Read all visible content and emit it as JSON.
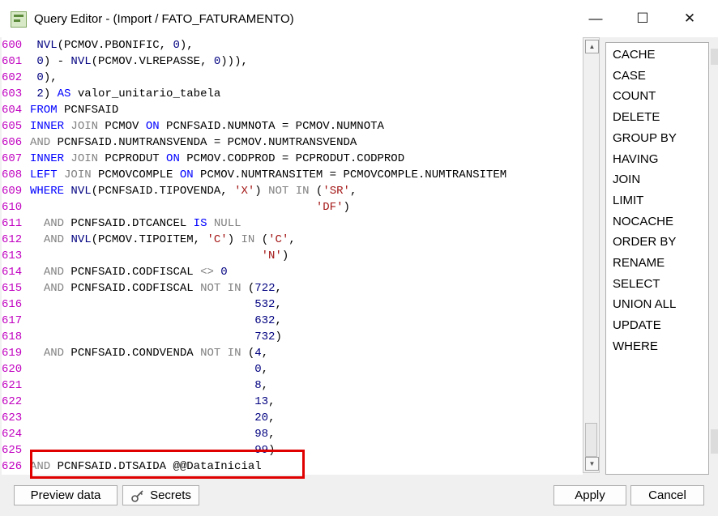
{
  "window": {
    "title": "Query Editor - (Import / FATO_FATURAMENTO)",
    "minimize_glyph": "—",
    "maximize_glyph": "☐",
    "close_glyph": "✕"
  },
  "editor": {
    "lines": [
      {
        "no": "600",
        "segs": [
          [
            "pl",
            " "
          ],
          [
            "fn",
            "NVL"
          ],
          [
            "pl",
            "(PCMOV.PBONIFIC, "
          ],
          [
            "num",
            "0"
          ],
          [
            "pl",
            "),"
          ]
        ]
      },
      {
        "no": "601",
        "segs": [
          [
            "pl",
            " "
          ],
          [
            "num",
            "0"
          ],
          [
            "pl",
            ") - "
          ],
          [
            "fn",
            "NVL"
          ],
          [
            "pl",
            "(PCMOV.VLREPASSE, "
          ],
          [
            "num",
            "0"
          ],
          [
            "pl",
            ")))"
          ],
          [
            "pl",
            ","
          ]
        ]
      },
      {
        "no": "602",
        "segs": [
          [
            "pl",
            " "
          ],
          [
            "num",
            "0"
          ],
          [
            "pl",
            "),"
          ]
        ]
      },
      {
        "no": "603",
        "segs": [
          [
            "pl",
            " "
          ],
          [
            "num",
            "2"
          ],
          [
            "pl",
            ") "
          ],
          [
            "kw",
            "AS"
          ],
          [
            "pl",
            " valor_unitario_tabela"
          ]
        ]
      },
      {
        "no": "604",
        "segs": [
          [
            "kw",
            "FROM"
          ],
          [
            "pl",
            " PCNFSAID"
          ]
        ]
      },
      {
        "no": "605",
        "segs": [
          [
            "kw",
            "INNER"
          ],
          [
            "pl",
            " "
          ],
          [
            "op",
            "JOIN"
          ],
          [
            "pl",
            " PCMOV "
          ],
          [
            "kw",
            "ON"
          ],
          [
            "pl",
            " PCNFSAID.NUMNOTA = PCMOV.NUMNOTA"
          ]
        ]
      },
      {
        "no": "606",
        "segs": [
          [
            "op",
            "AND"
          ],
          [
            "pl",
            " PCNFSAID.NUMTRANSVENDA = PCMOV.NUMTRANSVENDA"
          ]
        ]
      },
      {
        "no": "607",
        "segs": [
          [
            "kw",
            "INNER"
          ],
          [
            "pl",
            " "
          ],
          [
            "op",
            "JOIN"
          ],
          [
            "pl",
            " PCPRODUT "
          ],
          [
            "kw",
            "ON"
          ],
          [
            "pl",
            " PCMOV.CODPROD = PCPRODUT.CODPROD"
          ]
        ]
      },
      {
        "no": "608",
        "segs": [
          [
            "kw",
            "LEFT"
          ],
          [
            "pl",
            " "
          ],
          [
            "op",
            "JOIN"
          ],
          [
            "pl",
            " PCMOVCOMPLE "
          ],
          [
            "kw",
            "ON"
          ],
          [
            "pl",
            " PCMOV.NUMTRANSITEM = PCMOVCOMPLE.NUMTRANSITEM"
          ]
        ]
      },
      {
        "no": "609",
        "segs": [
          [
            "kw",
            "WHERE"
          ],
          [
            "pl",
            " "
          ],
          [
            "fn",
            "NVL"
          ],
          [
            "pl",
            "(PCNFSAID.TIPOVENDA, "
          ],
          [
            "str",
            "'X'"
          ],
          [
            "pl",
            ") "
          ],
          [
            "op",
            "NOT IN"
          ],
          [
            "pl",
            " ("
          ],
          [
            "str",
            "'SR'"
          ],
          [
            "pl",
            ","
          ]
        ]
      },
      {
        "no": "610",
        "segs": [
          [
            "pl",
            "                                          "
          ],
          [
            "str",
            "'DF'"
          ],
          [
            "pl",
            ")"
          ]
        ]
      },
      {
        "no": "611",
        "segs": [
          [
            "pl",
            "  "
          ],
          [
            "op",
            "AND"
          ],
          [
            "pl",
            " PCNFSAID.DTCANCEL "
          ],
          [
            "kw",
            "IS"
          ],
          [
            "pl",
            " "
          ],
          [
            "op",
            "NULL"
          ]
        ]
      },
      {
        "no": "612",
        "segs": [
          [
            "pl",
            "  "
          ],
          [
            "op",
            "AND"
          ],
          [
            "pl",
            " "
          ],
          [
            "fn",
            "NVL"
          ],
          [
            "pl",
            "(PCMOV.TIPOITEM, "
          ],
          [
            "str",
            "'C'"
          ],
          [
            "pl",
            ") "
          ],
          [
            "op",
            "IN"
          ],
          [
            "pl",
            " ("
          ],
          [
            "str",
            "'C'"
          ],
          [
            "pl",
            ","
          ]
        ]
      },
      {
        "no": "613",
        "segs": [
          [
            "pl",
            "                                  "
          ],
          [
            "str",
            "'N'"
          ],
          [
            "pl",
            ")"
          ]
        ]
      },
      {
        "no": "614",
        "segs": [
          [
            "pl",
            "  "
          ],
          [
            "op",
            "AND"
          ],
          [
            "pl",
            " PCNFSAID.CODFISCAL "
          ],
          [
            "op",
            "<>"
          ],
          [
            "pl",
            " "
          ],
          [
            "num",
            "0"
          ]
        ]
      },
      {
        "no": "615",
        "segs": [
          [
            "pl",
            "  "
          ],
          [
            "op",
            "AND"
          ],
          [
            "pl",
            " PCNFSAID.CODFISCAL "
          ],
          [
            "op",
            "NOT IN"
          ],
          [
            "pl",
            " ("
          ],
          [
            "num",
            "722"
          ],
          [
            "pl",
            ","
          ]
        ]
      },
      {
        "no": "616",
        "segs": [
          [
            "pl",
            "                                 "
          ],
          [
            "num",
            "532"
          ],
          [
            "pl",
            ","
          ]
        ]
      },
      {
        "no": "617",
        "segs": [
          [
            "pl",
            "                                 "
          ],
          [
            "num",
            "632"
          ],
          [
            "pl",
            ","
          ]
        ]
      },
      {
        "no": "618",
        "segs": [
          [
            "pl",
            "                                 "
          ],
          [
            "num",
            "732"
          ],
          [
            "pl",
            ")"
          ]
        ]
      },
      {
        "no": "619",
        "segs": [
          [
            "pl",
            "  "
          ],
          [
            "op",
            "AND"
          ],
          [
            "pl",
            " PCNFSAID.CONDVENDA "
          ],
          [
            "op",
            "NOT IN"
          ],
          [
            "pl",
            " ("
          ],
          [
            "num",
            "4"
          ],
          [
            "pl",
            ","
          ]
        ]
      },
      {
        "no": "620",
        "segs": [
          [
            "pl",
            "                                 "
          ],
          [
            "num",
            "0"
          ],
          [
            "pl",
            ","
          ]
        ]
      },
      {
        "no": "621",
        "segs": [
          [
            "pl",
            "                                 "
          ],
          [
            "num",
            "8"
          ],
          [
            "pl",
            ","
          ]
        ]
      },
      {
        "no": "622",
        "segs": [
          [
            "pl",
            "                                 "
          ],
          [
            "num",
            "13"
          ],
          [
            "pl",
            ","
          ]
        ]
      },
      {
        "no": "623",
        "segs": [
          [
            "pl",
            "                                 "
          ],
          [
            "num",
            "20"
          ],
          [
            "pl",
            ","
          ]
        ]
      },
      {
        "no": "624",
        "segs": [
          [
            "pl",
            "                                 "
          ],
          [
            "num",
            "98"
          ],
          [
            "pl",
            ","
          ]
        ]
      },
      {
        "no": "625",
        "segs": [
          [
            "pl",
            "                                 "
          ],
          [
            "num",
            "99"
          ],
          [
            "pl",
            ")"
          ]
        ]
      },
      {
        "no": "626",
        "segs": [
          [
            "op",
            "AND"
          ],
          [
            "pl",
            " PCNFSAID.DTSAIDA @@DataInicial"
          ]
        ]
      }
    ]
  },
  "keywords": [
    "CACHE",
    "CASE",
    "COUNT",
    "DELETE",
    "GROUP BY",
    "HAVING",
    "JOIN",
    "LIMIT",
    "NOCACHE",
    "ORDER BY",
    "RENAME",
    "SELECT",
    "UNION ALL",
    "UPDATE",
    "WHERE"
  ],
  "footer": {
    "preview_label": "Preview data",
    "secrets_label": "Secrets",
    "apply_label": "Apply",
    "cancel_label": "Cancel"
  },
  "colors": {
    "keyword": "#0000ff",
    "line_number": "#c000c0",
    "string": "#a31515",
    "highlight_box": "#e00000"
  }
}
